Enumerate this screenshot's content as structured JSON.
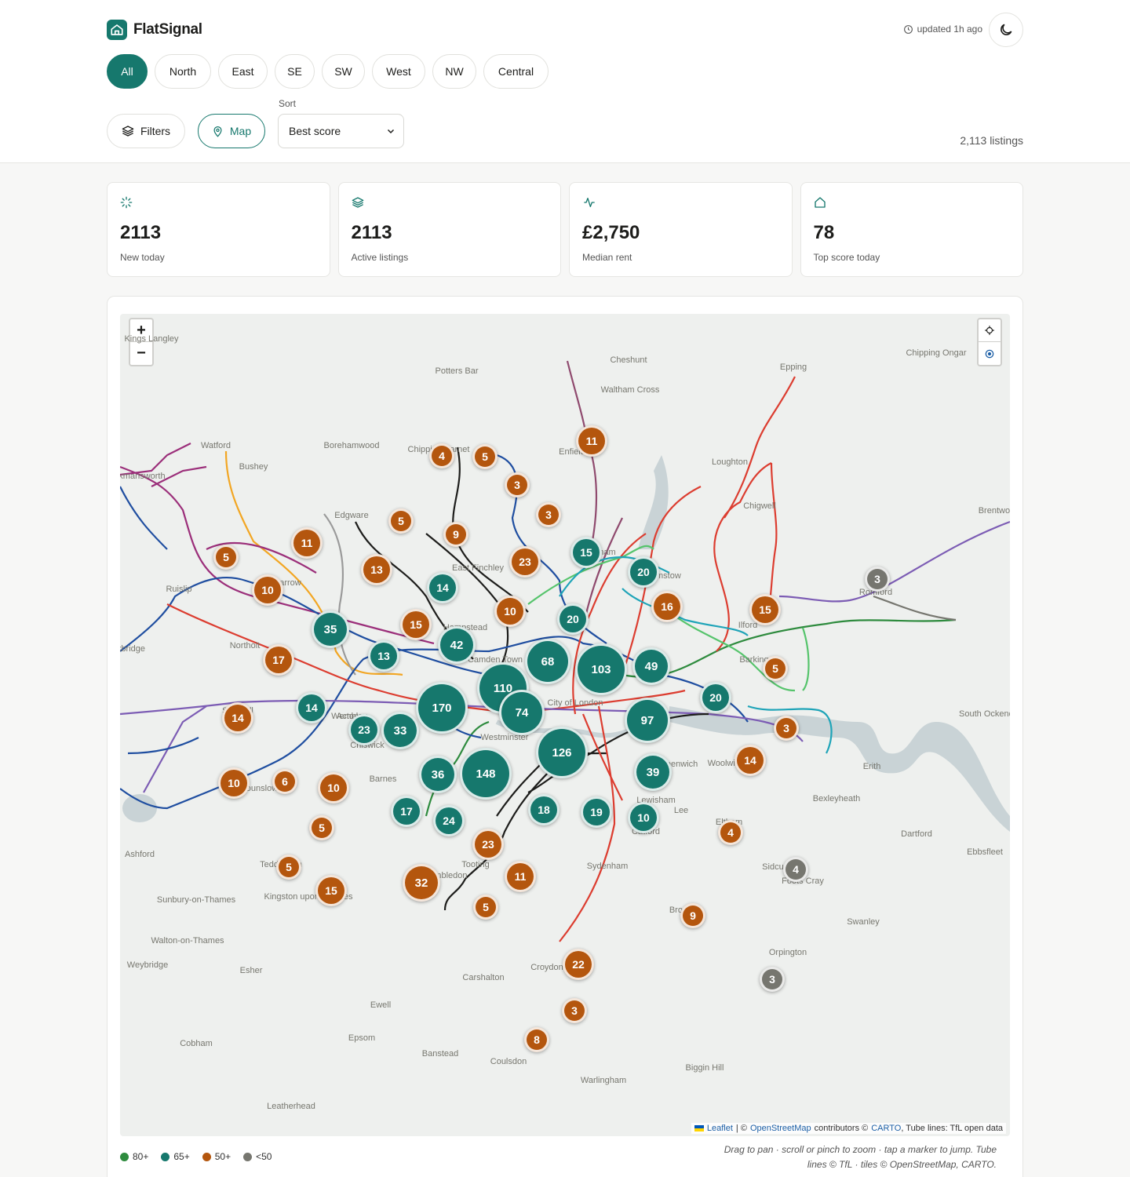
{
  "app": {
    "name": "FlatSignal",
    "updated": "updated 1h ago",
    "listing_count": "2,113 listings"
  },
  "regions": [
    {
      "label": "All",
      "active": true
    },
    {
      "label": "North",
      "active": false
    },
    {
      "label": "East",
      "active": false
    },
    {
      "label": "SE",
      "active": false
    },
    {
      "label": "SW",
      "active": false
    },
    {
      "label": "West",
      "active": false
    },
    {
      "label": "NW",
      "active": false
    },
    {
      "label": "Central",
      "active": false
    }
  ],
  "toolbar": {
    "filters_label": "Filters",
    "map_label": "Map",
    "sort_label": "Sort",
    "sort_value": "Best score"
  },
  "stats": [
    {
      "icon": "sparkle-icon",
      "value": "2113",
      "label": "New today"
    },
    {
      "icon": "layers-icon",
      "value": "2113",
      "label": "Active listings"
    },
    {
      "icon": "pulse-icon",
      "value": "£2,750",
      "label": "Median rent"
    },
    {
      "icon": "home-icon",
      "value": "78",
      "label": "Top score today"
    }
  ],
  "map": {
    "zoom_in": "+",
    "zoom_out": "−",
    "places": [
      "Kings Langley",
      "Potters Bar",
      "Cheshunt",
      "Epping",
      "Chipping Ongar",
      "Waltham Cross",
      "Watford",
      "Borehamwood",
      "Chipping Barnet",
      "Enfield",
      "Loughton",
      "Bushey",
      "Rickmansworth",
      "Edgware",
      "Chigwell",
      "Brentwood",
      "East Finchley",
      "Tottenham",
      "Walthamstow",
      "Harrow",
      "Ruislip",
      "Hampstead",
      "Romford",
      "Ilford",
      "Uxbridge",
      "Northolt",
      "Camden Town",
      "Barking",
      "Wembley",
      "City of London",
      "Southall",
      "Westminster",
      "South Ockendon",
      "Acton",
      "Chiswick",
      "Woolwich",
      "Greenwich",
      "Erith",
      "Hounslow",
      "Barnes",
      "Bexleyheath",
      "Lewisham",
      "Lee",
      "Eltham",
      "Dartford",
      "Catford",
      "Ashford",
      "Ebbsfleet",
      "Teddington",
      "Tooting",
      "Sydenham",
      "Wimbledon",
      "Sidcup",
      "Foots Cray",
      "Kingston upon Thames",
      "Sunbury-on-Thames",
      "Bromley",
      "Swanley",
      "Walton-on-Thames",
      "Orpington",
      "Weybridge",
      "Esher",
      "Croydon",
      "Carshalton",
      "Ewell",
      "Epsom",
      "Cobham",
      "Banstead",
      "Coulsdon",
      "Biggin Hill",
      "Warlingham",
      "Leatherhead"
    ],
    "markers": [
      {
        "n": 11,
        "c": "orange"
      },
      {
        "n": 4,
        "c": "orange"
      },
      {
        "n": 5,
        "c": "orange"
      },
      {
        "n": 3,
        "c": "orange"
      },
      {
        "n": 3,
        "c": "orange"
      },
      {
        "n": 5,
        "c": "orange"
      },
      {
        "n": 9,
        "c": "orange"
      },
      {
        "n": 23,
        "c": "orange"
      },
      {
        "n": 15,
        "c": "teal"
      },
      {
        "n": 11,
        "c": "orange"
      },
      {
        "n": 13,
        "c": "orange"
      },
      {
        "n": 5,
        "c": "orange"
      },
      {
        "n": 20,
        "c": "teal"
      },
      {
        "n": 3,
        "c": "grey"
      },
      {
        "n": 14,
        "c": "teal"
      },
      {
        "n": 10,
        "c": "orange"
      },
      {
        "n": 16,
        "c": "orange"
      },
      {
        "n": 15,
        "c": "orange"
      },
      {
        "n": 10,
        "c": "orange"
      },
      {
        "n": 20,
        "c": "teal"
      },
      {
        "n": 35,
        "c": "teal"
      },
      {
        "n": 15,
        "c": "orange"
      },
      {
        "n": 42,
        "c": "teal"
      },
      {
        "n": 17,
        "c": "orange"
      },
      {
        "n": 13,
        "c": "teal"
      },
      {
        "n": 68,
        "c": "teal"
      },
      {
        "n": 103,
        "c": "teal"
      },
      {
        "n": 49,
        "c": "teal"
      },
      {
        "n": 5,
        "c": "orange"
      },
      {
        "n": 110,
        "c": "teal"
      },
      {
        "n": 20,
        "c": "teal"
      },
      {
        "n": 170,
        "c": "teal"
      },
      {
        "n": 14,
        "c": "teal"
      },
      {
        "n": 14,
        "c": "orange"
      },
      {
        "n": 74,
        "c": "teal"
      },
      {
        "n": 97,
        "c": "teal"
      },
      {
        "n": 23,
        "c": "teal"
      },
      {
        "n": 33,
        "c": "teal"
      },
      {
        "n": 3,
        "c": "orange"
      },
      {
        "n": 126,
        "c": "teal"
      },
      {
        "n": 14,
        "c": "orange"
      },
      {
        "n": 36,
        "c": "teal"
      },
      {
        "n": 148,
        "c": "teal"
      },
      {
        "n": 39,
        "c": "teal"
      },
      {
        "n": 10,
        "c": "orange"
      },
      {
        "n": 6,
        "c": "orange"
      },
      {
        "n": 10,
        "c": "orange"
      },
      {
        "n": 17,
        "c": "teal"
      },
      {
        "n": 18,
        "c": "teal"
      },
      {
        "n": 19,
        "c": "teal"
      },
      {
        "n": 24,
        "c": "teal"
      },
      {
        "n": 10,
        "c": "teal"
      },
      {
        "n": 5,
        "c": "orange"
      },
      {
        "n": 4,
        "c": "orange"
      },
      {
        "n": 23,
        "c": "orange"
      },
      {
        "n": 5,
        "c": "orange"
      },
      {
        "n": 4,
        "c": "grey"
      },
      {
        "n": 11,
        "c": "orange"
      },
      {
        "n": 32,
        "c": "orange"
      },
      {
        "n": 15,
        "c": "orange"
      },
      {
        "n": 5,
        "c": "orange"
      },
      {
        "n": 9,
        "c": "orange"
      },
      {
        "n": 22,
        "c": "orange"
      },
      {
        "n": 3,
        "c": "grey"
      },
      {
        "n": 3,
        "c": "orange"
      },
      {
        "n": 8,
        "c": "orange"
      }
    ],
    "attribution": {
      "leaflet": "Leaflet",
      "sep": "| ©",
      "osm": "OpenStreetMap",
      "contrib": "contributors ©",
      "carto": "CARTO",
      "tfl": ", Tube lines: TfL open data"
    },
    "note": "Drag to pan · scroll or pinch to zoom · tap a marker to jump. Tube lines © TfL · tiles © OpenStreetMap, CARTO."
  },
  "legend": [
    {
      "label": "80+",
      "color": "#2e8b3e"
    },
    {
      "label": "65+",
      "color": "#16786d"
    },
    {
      "label": "50+",
      "color": "#b4560e"
    },
    {
      "label": "<50",
      "color": "#76766f"
    }
  ],
  "colors": {
    "accent": "#16786d",
    "orange": "#b4560e",
    "grey": "#76766f"
  }
}
